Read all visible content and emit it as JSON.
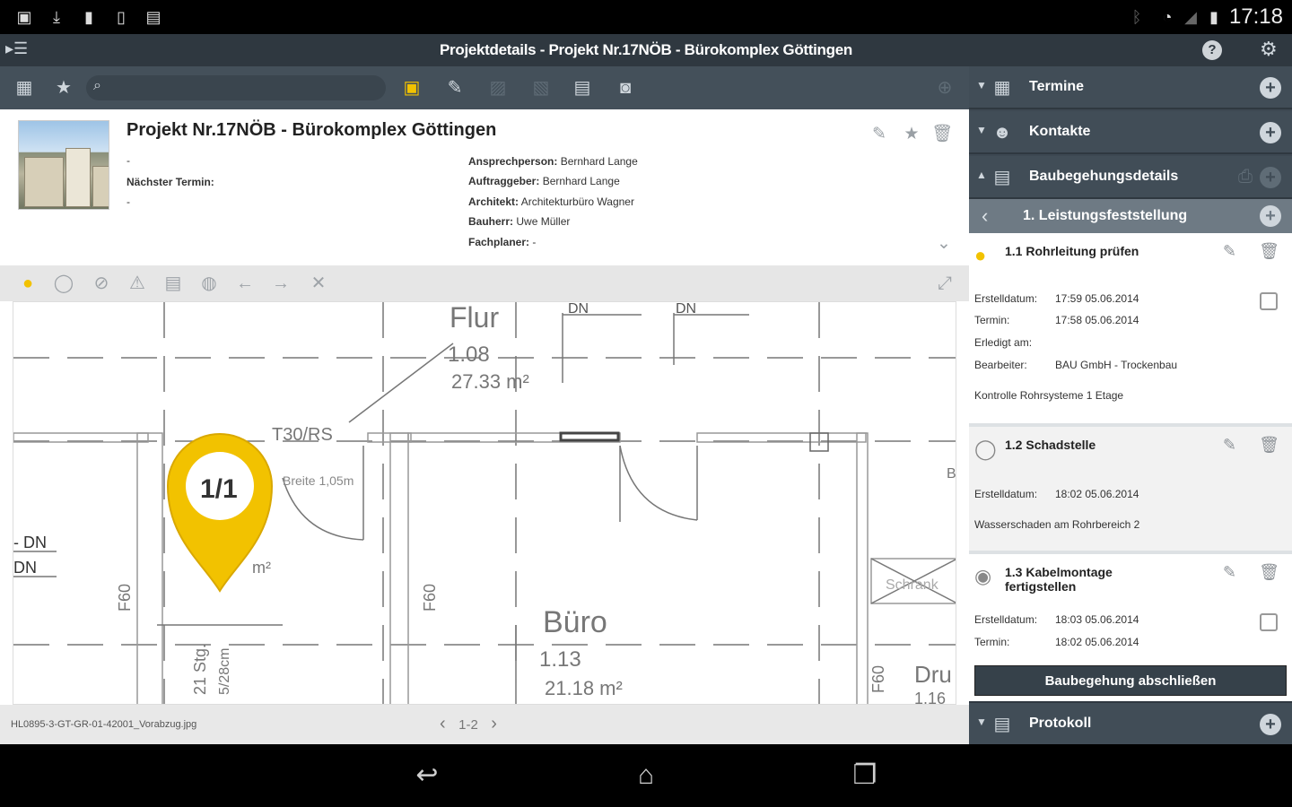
{
  "statusbar": {
    "time": "17:18"
  },
  "titlebar": {
    "title": "Projektdetails - Projekt Nr.17NÖB - Bürokomplex Göttingen"
  },
  "search": {
    "placeholder": ""
  },
  "project": {
    "title": "Projekt Nr.17NÖB - Bürokomplex Göttingen",
    "dot1": "-",
    "next_label": "Nächster Termin:",
    "dot2": "-",
    "fields": [
      {
        "key": "Ansprechperson:",
        "value": "Bernhard Lange"
      },
      {
        "key": "Auftraggeber:",
        "value": "Bernhard Lange"
      },
      {
        "key": "Architekt:",
        "value": "Architekturbüro Wagner"
      },
      {
        "key": "Bauherr:",
        "value": "Uwe Müller"
      },
      {
        "key": "Fachplaner:",
        "value": "-"
      }
    ]
  },
  "plan": {
    "labels": {
      "flur": "Flur",
      "flur_num": "1.08",
      "flur_area": "27.33 m²",
      "t30": "T30/RS",
      "breite": "Breite 1,05m",
      "buero": "Büro",
      "buero_num": "1.13",
      "buero_area": "21.18 m²",
      "dn1": "DN",
      "dn2": "DN",
      "dn3": "- DN",
      "dn4": "DN",
      "f60a": "F60",
      "f60b": "F60",
      "f60c": "F60",
      "stg": "21 Stg.",
      "stg2": "5/28cm",
      "m2": "m²",
      "schrank": "Schrank",
      "dru": "Dru",
      "dru_num": "1.16",
      "b": "B"
    },
    "marker_label": "1/1",
    "filename": "HL0895-3-GT-GR-01-42001_Vorabzug.jpg",
    "pager": "1-2"
  },
  "sidebar": {
    "termine": "Termine",
    "kontakte": "Kontakte",
    "baubegehung": "Baubegehungsdetails",
    "leistung": "1. Leistungsfeststellung",
    "protokoll": "Protokoll",
    "finish_button": "Baubegehung abschließen"
  },
  "tasks": [
    {
      "name": "1.1 Rohrleitung prüfen",
      "rows": [
        {
          "k": "Erstelldatum:",
          "v": "17:59 05.06.2014"
        },
        {
          "k": "Termin:",
          "v": "17:58 05.06.2014"
        },
        {
          "k": "Erledigt am:",
          "v": ""
        },
        {
          "k": "Bearbeiter:",
          "v": "BAU GmbH - Trockenbau"
        }
      ],
      "note": "Kontrolle Rohrsysteme 1 Etage"
    },
    {
      "name": "1.2 Schadstelle",
      "rows": [
        {
          "k": "Erstelldatum:",
          "v": "18:02 05.06.2014"
        }
      ],
      "note": "Wasserschaden am Rohrbereich 2"
    },
    {
      "name": "1.3 Kabelmontage fertigstellen",
      "rows": [
        {
          "k": "Erstelldatum:",
          "v": "18:03 05.06.2014"
        },
        {
          "k": "Termin:",
          "v": "18:02 05.06.2014"
        }
      ],
      "note": ""
    }
  ],
  "colors": {
    "accent": "#f2c200",
    "sidebar": "#3d4852",
    "titlebar": "#2f3840"
  }
}
